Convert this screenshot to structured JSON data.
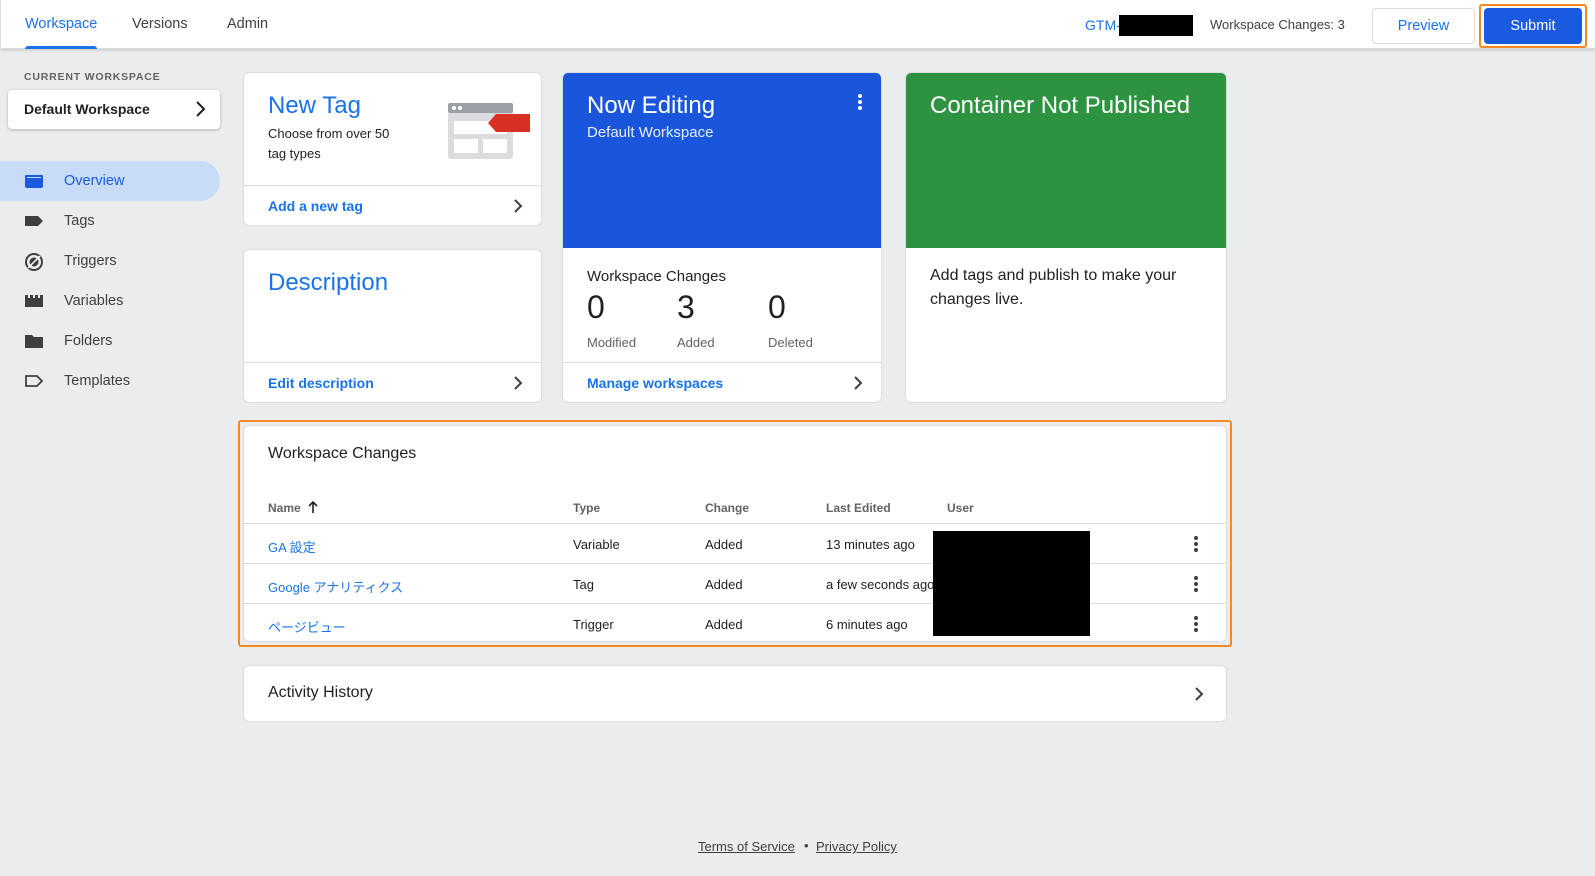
{
  "topbar": {
    "tabs": [
      {
        "label": "Workspace",
        "active": true
      },
      {
        "label": "Versions",
        "active": false
      },
      {
        "label": "Admin",
        "active": false
      }
    ],
    "container_id_prefix": "GTM-",
    "workspace_changes": "Workspace Changes: 3",
    "preview_label": "Preview",
    "submit_label": "Submit"
  },
  "sidebar": {
    "current_workspace_label": "CURRENT WORKSPACE",
    "current_workspace_name": "Default Workspace",
    "items": [
      {
        "label": "Overview",
        "icon": "overview-icon",
        "active": true
      },
      {
        "label": "Tags",
        "icon": "tag-icon",
        "active": false
      },
      {
        "label": "Triggers",
        "icon": "trigger-icon",
        "active": false
      },
      {
        "label": "Variables",
        "icon": "variables-icon",
        "active": false
      },
      {
        "label": "Folders",
        "icon": "folder-icon",
        "active": false
      },
      {
        "label": "Templates",
        "icon": "template-icon",
        "active": false
      }
    ]
  },
  "new_tag": {
    "title": "New Tag",
    "subtitle_line1": "Choose from over 50",
    "subtitle_line2": "tag types",
    "link": "Add a new tag"
  },
  "description": {
    "title": "Description",
    "link": "Edit description"
  },
  "now_editing": {
    "title": "Now Editing",
    "subtitle": "Default Workspace",
    "changes_title": "Workspace Changes",
    "stats": [
      {
        "value": "0",
        "label": "Modified"
      },
      {
        "value": "3",
        "label": "Added"
      },
      {
        "value": "0",
        "label": "Deleted"
      }
    ],
    "link": "Manage workspaces"
  },
  "container": {
    "title": "Container Not Published",
    "body_line1": "Add tags and publish to make your",
    "body_line2": "changes live."
  },
  "workspace_changes_table": {
    "title": "Workspace Changes",
    "columns": [
      "Name",
      "Type",
      "Change",
      "Last Edited",
      "User"
    ],
    "rows": [
      {
        "name": "GA 設定",
        "type": "Variable",
        "change": "Added",
        "last_edited": "13 minutes ago"
      },
      {
        "name": "Google アナリティクス",
        "type": "Tag",
        "change": "Added",
        "last_edited": "a few seconds ago"
      },
      {
        "name": "ページビュー",
        "type": "Trigger",
        "change": "Added",
        "last_edited": "6 minutes ago"
      }
    ]
  },
  "activity_history": {
    "title": "Activity History"
  },
  "footer": {
    "terms": "Terms of Service",
    "separator": "•",
    "privacy": "Privacy Policy"
  },
  "colors": {
    "accent": "#1a73e8",
    "submit": "#1a5ae0",
    "now_editing": "#1a56db",
    "not_published": "#2e9340",
    "highlight": "#f5891f"
  }
}
